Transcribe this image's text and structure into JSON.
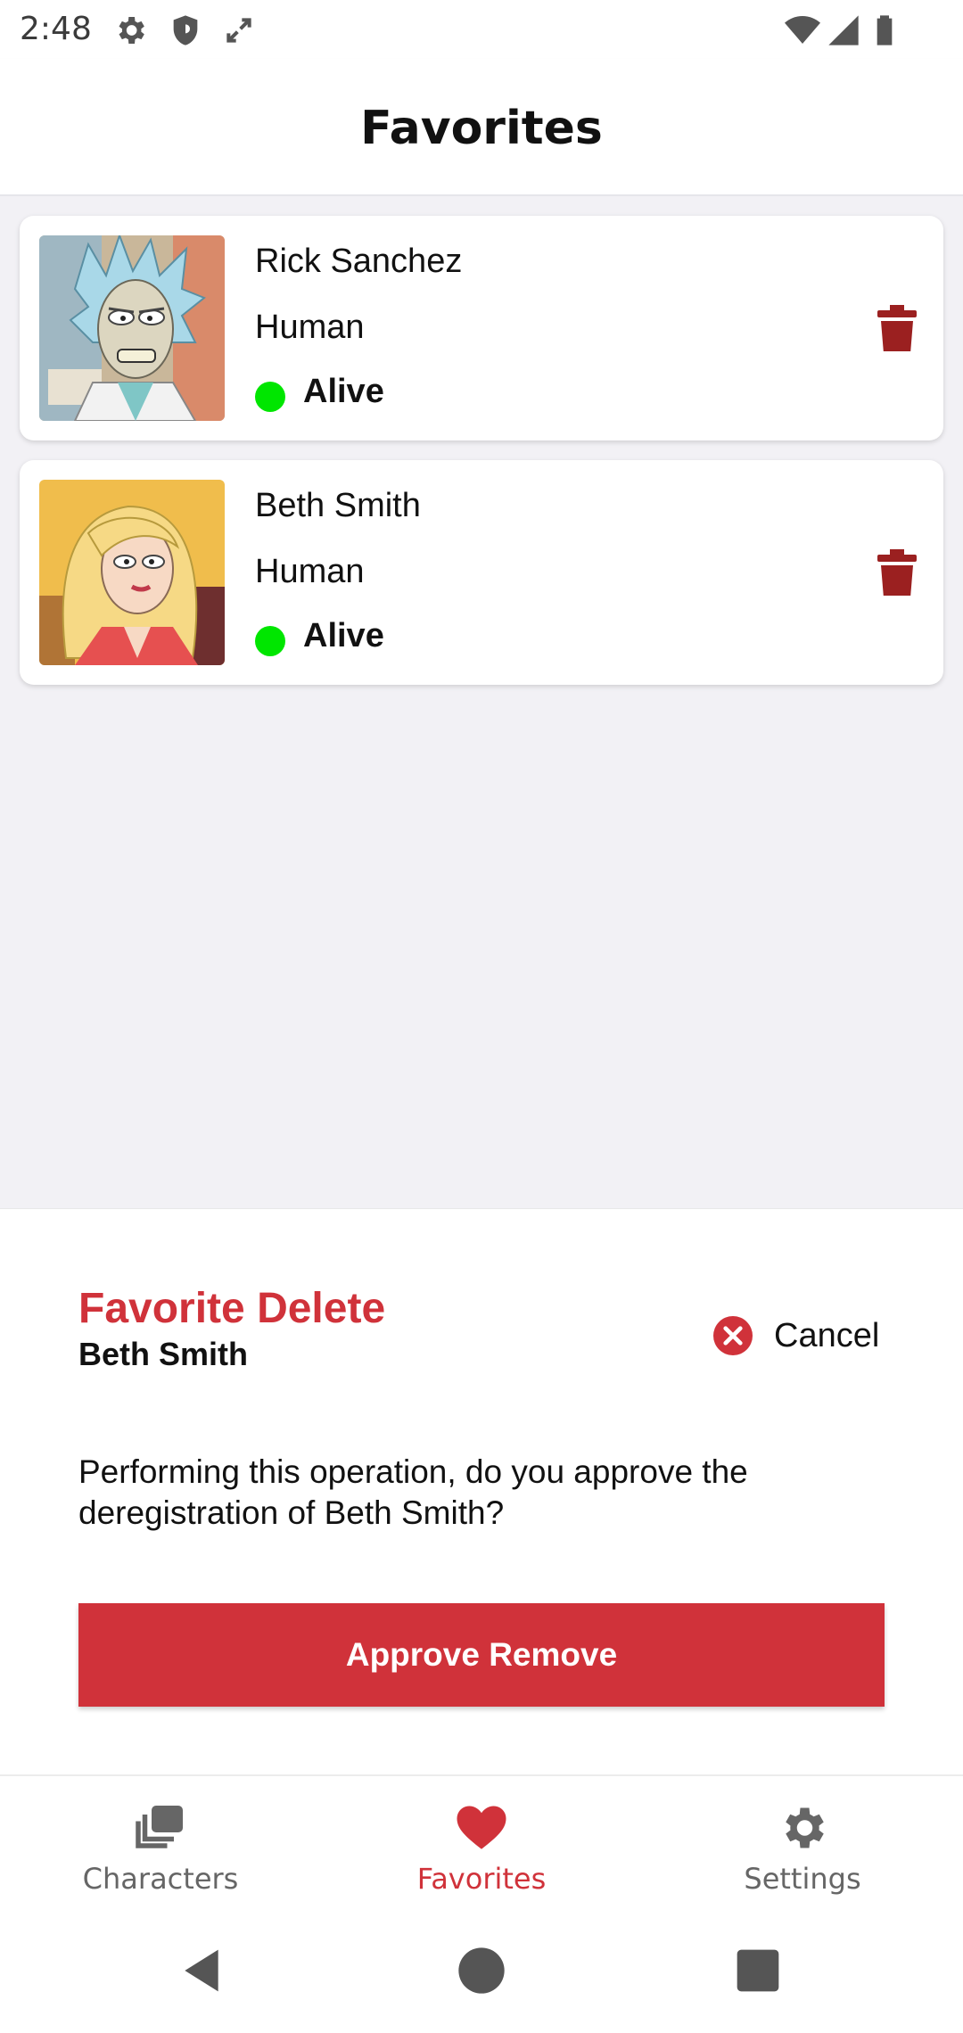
{
  "status_bar": {
    "time": "2:48",
    "icons": [
      "gear-icon",
      "shield-icon",
      "expand-icon",
      "wifi-icon",
      "cellular-icon",
      "battery-icon"
    ]
  },
  "app_bar": {
    "title": "Favorites"
  },
  "favorites": [
    {
      "name": "Rick Sanchez",
      "species": "Human",
      "status": "Alive",
      "status_color": "#00e600"
    },
    {
      "name": "Beth Smith",
      "species": "Human",
      "status": "Alive",
      "status_color": "#00e600"
    }
  ],
  "dialog": {
    "title": "Favorite Delete",
    "subtitle": "Beth Smith",
    "cancel_label": "Cancel",
    "message": "Performing this operation, do you approve the deregistration of Beth Smith?",
    "approve_label": "Approve Remove"
  },
  "bottom_nav": {
    "items": [
      {
        "label": "Characters",
        "icon": "stacked-cards-icon",
        "active": false
      },
      {
        "label": "Favorites",
        "icon": "heart-icon",
        "active": true
      },
      {
        "label": "Settings",
        "icon": "gear-icon",
        "active": false
      }
    ]
  },
  "colors": {
    "accent": "#d0323a",
    "delete": "#9b2020",
    "inactive": "#666666",
    "background": "#f2f1f5"
  }
}
